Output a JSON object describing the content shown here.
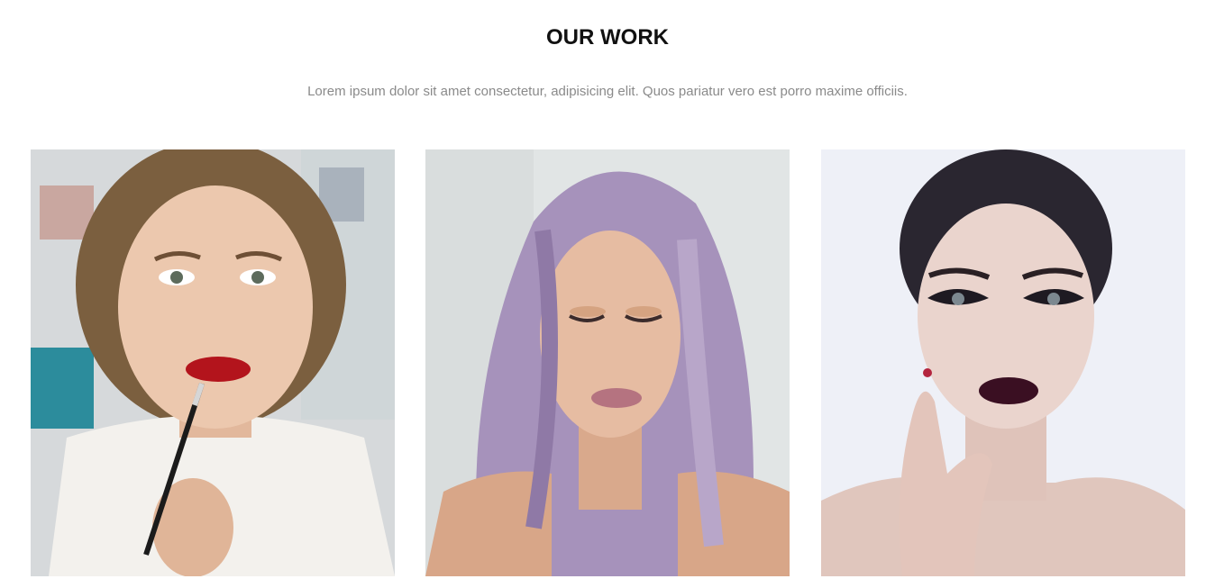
{
  "section": {
    "title": "OUR WORK",
    "subtitle": "Lorem ipsum dolor sit amet consectetur, adipisicing elit. Quos pariatur vero est porro maxime officiis."
  },
  "gallery": {
    "items": [
      {
        "subject": "woman applying red lipstick with brush",
        "palette": {
          "bg": "#d9dcde",
          "skin": "#e8c2a8",
          "hair": "#7a5f3e",
          "accent": "#b3141c"
        }
      },
      {
        "subject": "woman with long lavender wavy hair",
        "palette": {
          "bg": "#dfe3e3",
          "skin": "#e2b79e",
          "hair": "#a58fb8",
          "accent": "#b0707c"
        }
      },
      {
        "subject": "woman with dark lips and dramatic eye makeup",
        "palette": {
          "bg": "#eef0f6",
          "skin": "#e6cfc8",
          "hair": "#2a2630",
          "accent": "#3a0f22"
        }
      }
    ]
  }
}
